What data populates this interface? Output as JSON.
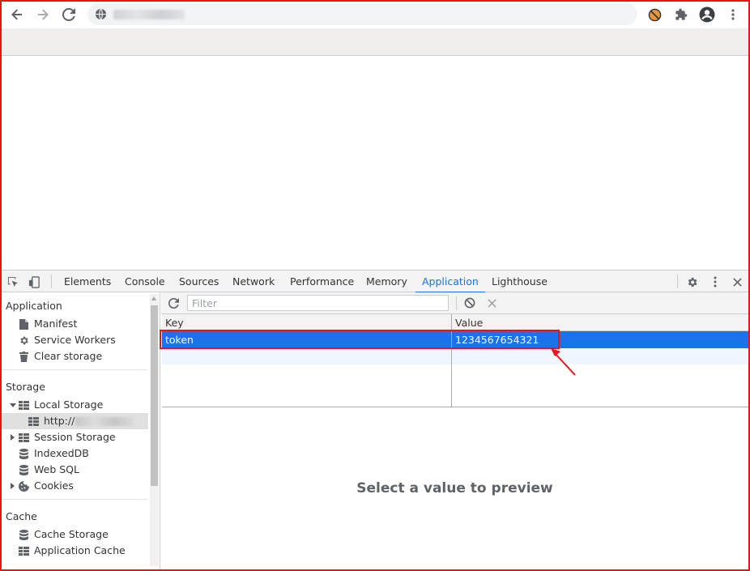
{
  "browser": {
    "back_icon": "arrow-left-icon",
    "forward_icon": "arrow-right-icon",
    "reload_icon": "reload-icon",
    "site_info_icon": "globe-icon",
    "extensions": [
      "blocked-extension-icon",
      "puzzle-icon",
      "account-icon",
      "kebab-menu-icon"
    ]
  },
  "devtools": {
    "tabs": [
      {
        "label": "Elements"
      },
      {
        "label": "Console"
      },
      {
        "label": "Sources"
      },
      {
        "label": "Network"
      },
      {
        "label": "Performance"
      },
      {
        "label": "Memory"
      },
      {
        "label": "Application",
        "active": true
      },
      {
        "label": "Lighthouse"
      }
    ],
    "accent": "#1a73e8"
  },
  "sidebar": {
    "sections": [
      {
        "title": "Application",
        "items": [
          "Manifest",
          "Service Workers",
          "Clear storage"
        ]
      },
      {
        "title": "Storage",
        "items": [
          "Local Storage",
          "http://",
          "Session Storage",
          "IndexedDB",
          "Web SQL",
          "Cookies"
        ]
      },
      {
        "title": "Cache",
        "items": [
          "Cache Storage",
          "Application Cache"
        ]
      }
    ]
  },
  "storage_view": {
    "filter_placeholder": "Filter",
    "columns": [
      "Key",
      "Value"
    ],
    "rows": [
      {
        "key": "token",
        "value": "1234567654321",
        "selected": true
      }
    ],
    "preview_message": "Select a value to preview"
  },
  "annotation": {
    "highlight_color": "#e8141a"
  }
}
